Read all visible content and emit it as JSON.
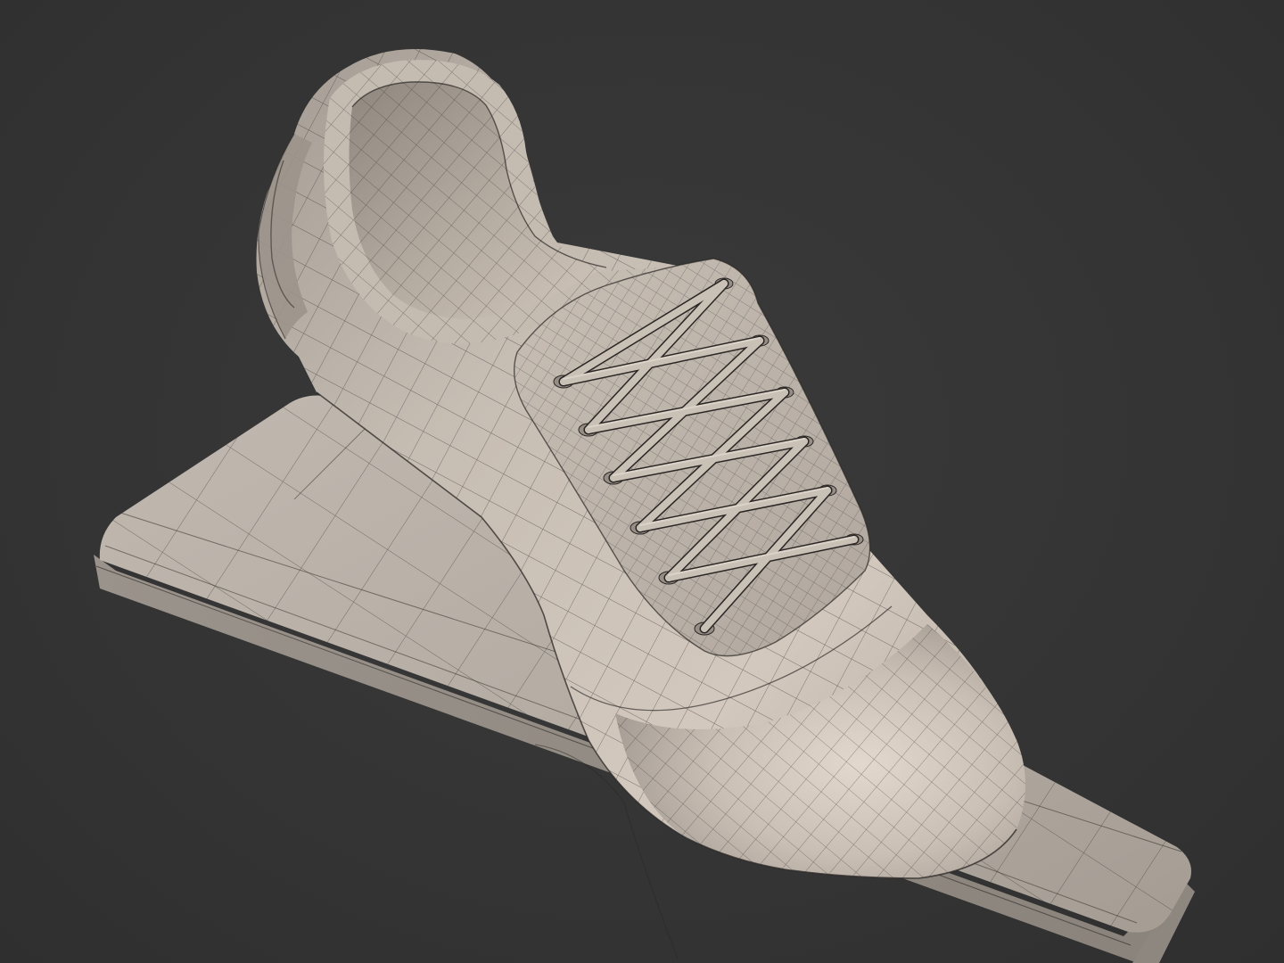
{
  "scene": {
    "background_color": "#353535",
    "model_color": "#b9b1a8",
    "wire_color": "#2a2624",
    "objects": [
      "shoe-model",
      "display-base"
    ]
  }
}
